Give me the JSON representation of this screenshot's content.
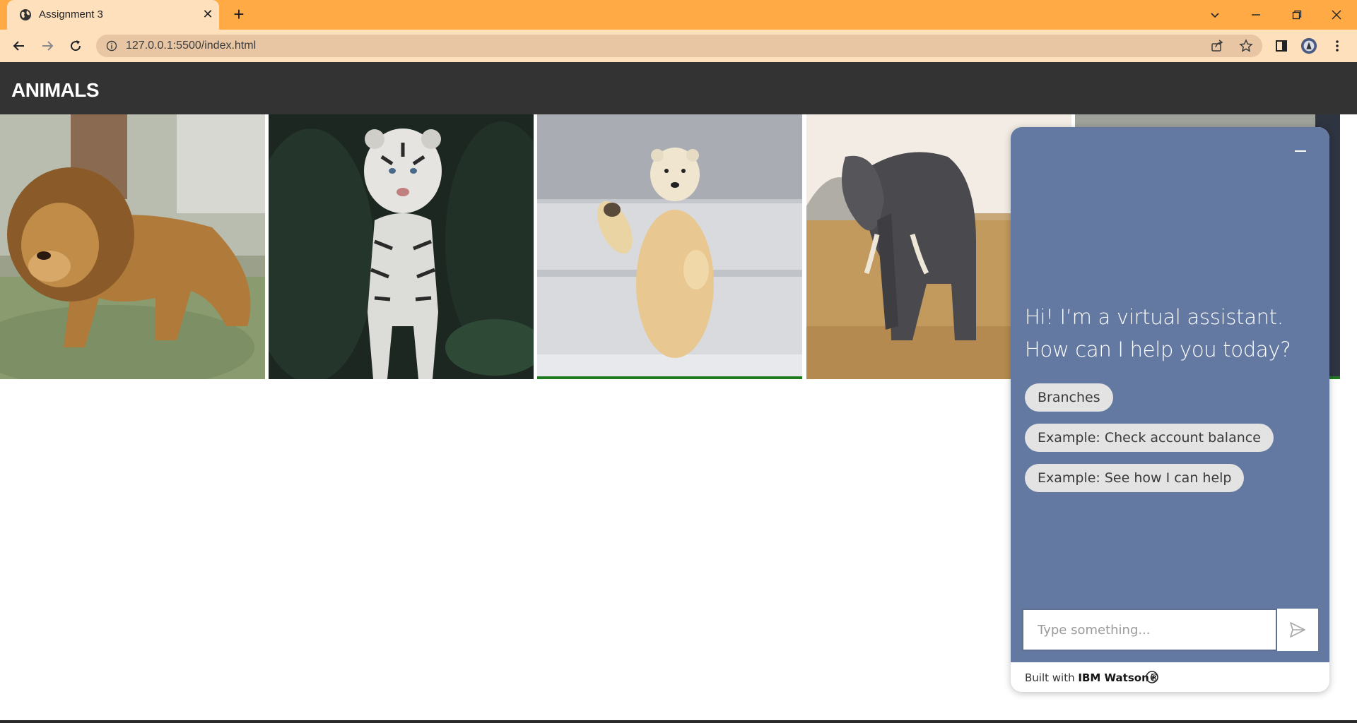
{
  "browser": {
    "tab_title": "Assignment 3",
    "url": "127.0.0.1:5500/index.html"
  },
  "page": {
    "site_title": "ANIMALS",
    "images": [
      {
        "name": "lion",
        "alt": "Lion"
      },
      {
        "name": "white-tiger",
        "alt": "White tiger"
      },
      {
        "name": "polar-bear",
        "alt": "Polar bear"
      },
      {
        "name": "elephant",
        "alt": "Elephant"
      },
      {
        "name": "fifth-animal",
        "alt": "Animal"
      }
    ]
  },
  "chat": {
    "greeting": "Hi! I’m a virtual assistant. How can I help you today?",
    "chips": [
      "Branches",
      "Example: Check account balance",
      "Example: See how I can help"
    ],
    "input_placeholder": "Type something...",
    "footer_prefix": "Built with ",
    "footer_brand": "IBM Watson®",
    "colors": {
      "panel": "#6479a1",
      "chip": "#e3e3e3",
      "input_border": "#5f6f8f"
    }
  },
  "colors": {
    "tabstrip": "#ffaa45",
    "toolbar": "#ffe0bd",
    "omnibox": "#e8c6a3",
    "header": "#333333"
  }
}
